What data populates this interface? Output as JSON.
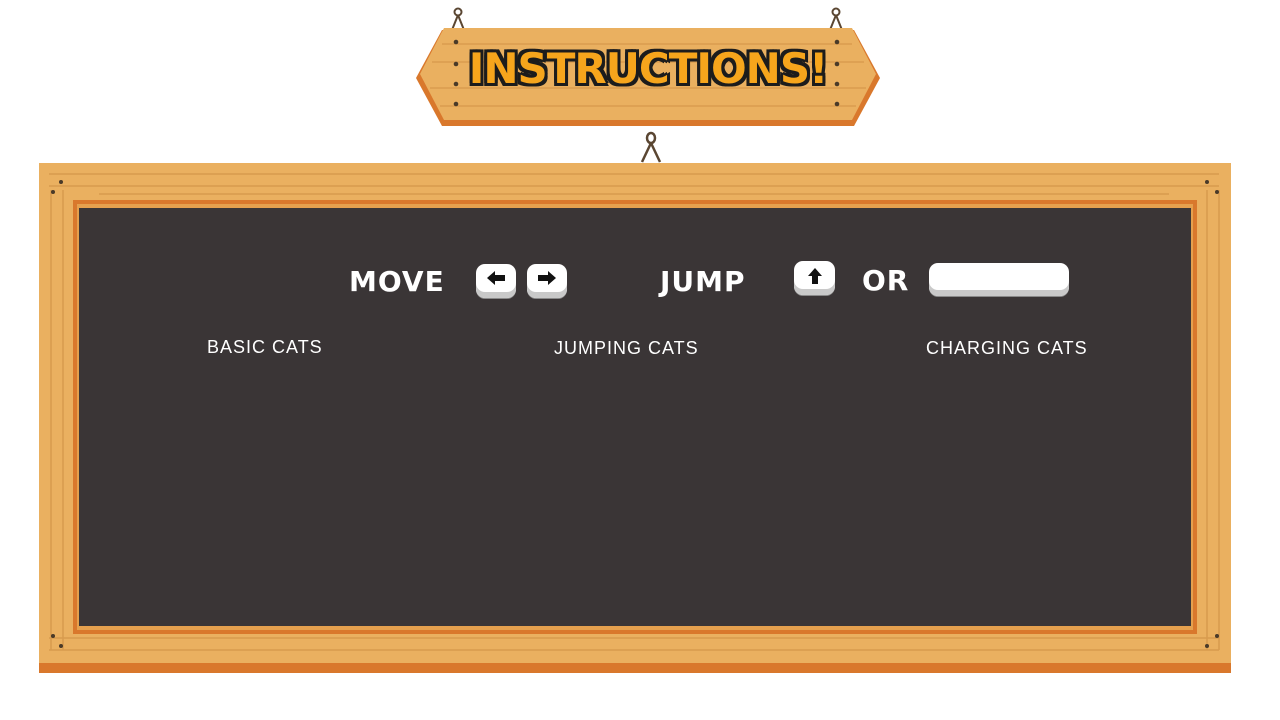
{
  "title": {
    "text": "INSTRUCTIONS!"
  },
  "controls": {
    "move_label": "MOVE",
    "jump_label": "JUMP",
    "or_label": "OR",
    "keys": {
      "left": "left-arrow-icon",
      "right": "right-arrow-icon",
      "up": "up-arrow-icon",
      "space": "spacebar-icon"
    }
  },
  "cats": {
    "basic": "BASIC CATS",
    "jumping": "JUMPING CATS",
    "charging": "CHARGING CATS"
  },
  "colors": {
    "wood": "#e9a95a",
    "wood_dark": "#d9782c",
    "chalkboard": "#3a3536",
    "title_fill": "#f6a51c",
    "title_outline": "#1c1c1c"
  }
}
